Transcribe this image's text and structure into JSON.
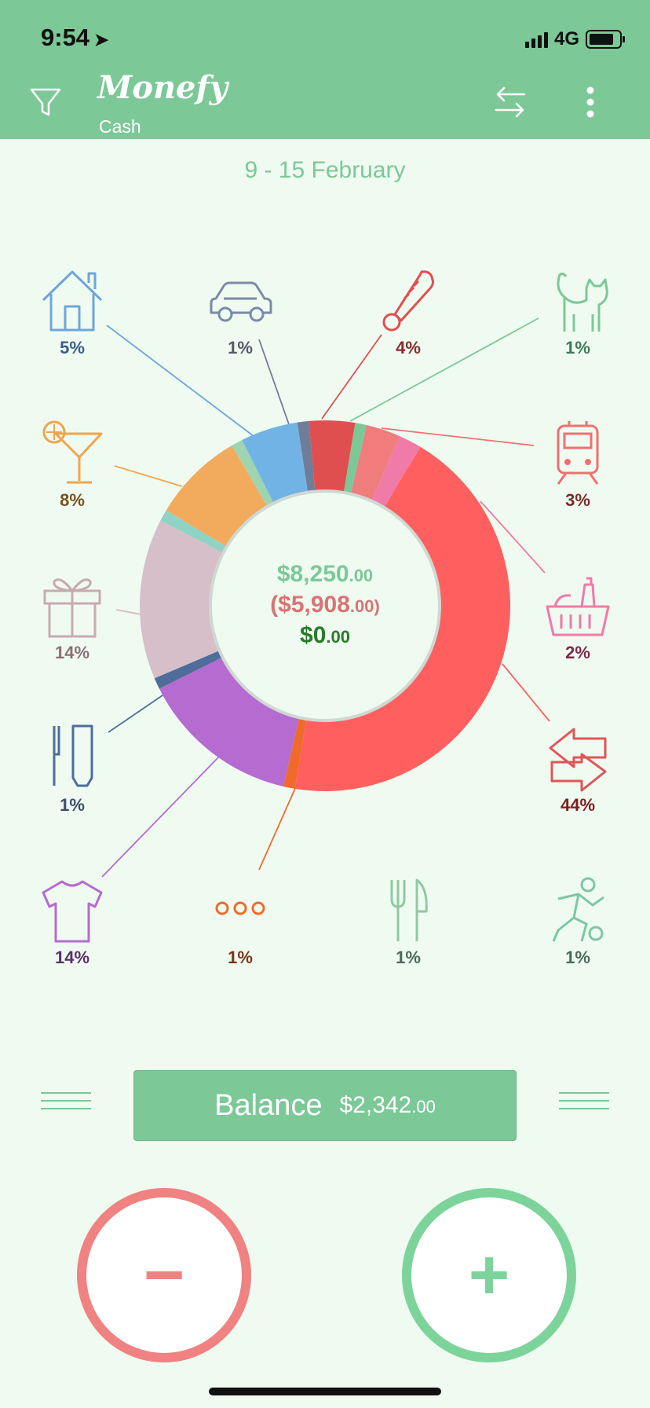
{
  "status": {
    "time": "9:54",
    "network": "4G"
  },
  "header": {
    "title": "Monefy",
    "account": "Cash"
  },
  "period": "9 - 15 February",
  "totals": {
    "income_main": "$8,250",
    "income_cents": ".00",
    "expense_main": "($5,908",
    "expense_cents": ".00)",
    "net_main": "$0",
    "net_cents": ".00"
  },
  "categories": [
    {
      "key": "house",
      "icon": "house-icon",
      "percent": "5%",
      "color": "#6fa6d9",
      "text_color": "#3b5d86"
    },
    {
      "key": "car",
      "icon": "car-icon",
      "percent": "1%",
      "color": "#7a8aa8",
      "text_color": "#555a66"
    },
    {
      "key": "health",
      "icon": "thermometer-icon",
      "percent": "4%",
      "color": "#e04f4f",
      "text_color": "#8a2b2b"
    },
    {
      "key": "pets",
      "icon": "cat-icon",
      "percent": "1%",
      "color": "#7cc897",
      "text_color": "#3e7a55"
    },
    {
      "key": "eating-out",
      "icon": "cocktail-icon",
      "percent": "8%",
      "color": "#f0a54b",
      "text_color": "#7a5020"
    },
    {
      "key": "transport",
      "icon": "train-icon",
      "percent": "3%",
      "color": "#f07070",
      "text_color": "#7a2b2b"
    },
    {
      "key": "gifts",
      "icon": "gift-icon",
      "percent": "14%",
      "color": "#d6b8c2",
      "text_color": "#8a7077"
    },
    {
      "key": "groceries",
      "icon": "basket-icon",
      "percent": "2%",
      "color": "#f07aa8",
      "text_color": "#7a2b4a"
    },
    {
      "key": "hygiene",
      "icon": "toiletries-icon",
      "percent": "1%",
      "color": "#4e6d9a",
      "text_color": "#3b4d6a"
    },
    {
      "key": "transfer",
      "icon": "arrows-icon",
      "percent": "44%",
      "color": "#ff5f5f",
      "text_color": "#7a1f1f"
    },
    {
      "key": "clothes",
      "icon": "tshirt-icon",
      "percent": "14%",
      "color": "#b56bd0",
      "text_color": "#5a2f6a"
    },
    {
      "key": "other",
      "icon": "dots-icon",
      "percent": "1%",
      "color": "#f06a2a",
      "text_color": "#7a3418"
    },
    {
      "key": "food",
      "icon": "fork-knife-icon",
      "percent": "1%",
      "color": "#8fc9a4",
      "text_color": "#4a6a55"
    },
    {
      "key": "sports",
      "icon": "soccer-icon",
      "percent": "1%",
      "color": "#7cc8a2",
      "text_color": "#4a6a5a"
    }
  ],
  "chart_data": {
    "type": "pie",
    "segments": [
      {
        "label": "Health",
        "value": 4,
        "color": "#e04f4f"
      },
      {
        "label": "Pets",
        "value": 1,
        "color": "#7cc897"
      },
      {
        "label": "Transport",
        "value": 3,
        "color": "#f07c7c"
      },
      {
        "label": "Groceries",
        "value": 2,
        "color": "#f07aa8"
      },
      {
        "label": "Transfer",
        "value": 44,
        "color": "#ff5f5f"
      },
      {
        "label": "Other",
        "value": 1,
        "color": "#f06a2a"
      },
      {
        "label": "Clothes",
        "value": 14,
        "color": "#b56bd0"
      },
      {
        "label": "Hygiene",
        "value": 1,
        "color": "#4e6d9a"
      },
      {
        "label": "Gifts",
        "value": 14,
        "color": "#d6bfc8"
      },
      {
        "label": "Food",
        "value": 1,
        "color": "#8fd3c4"
      },
      {
        "label": "Eating out",
        "value": 8,
        "color": "#f2ab5d"
      },
      {
        "label": "Sports",
        "value": 1,
        "color": "#9fd4b0"
      },
      {
        "label": "House",
        "value": 5,
        "color": "#72b3e6"
      },
      {
        "label": "Car",
        "value": 1,
        "color": "#6f7c9a"
      }
    ]
  },
  "balance": {
    "label": "Balance",
    "amount": "$2,342",
    "cents": ".00"
  },
  "actions": {
    "minus": "−",
    "plus": "+"
  }
}
